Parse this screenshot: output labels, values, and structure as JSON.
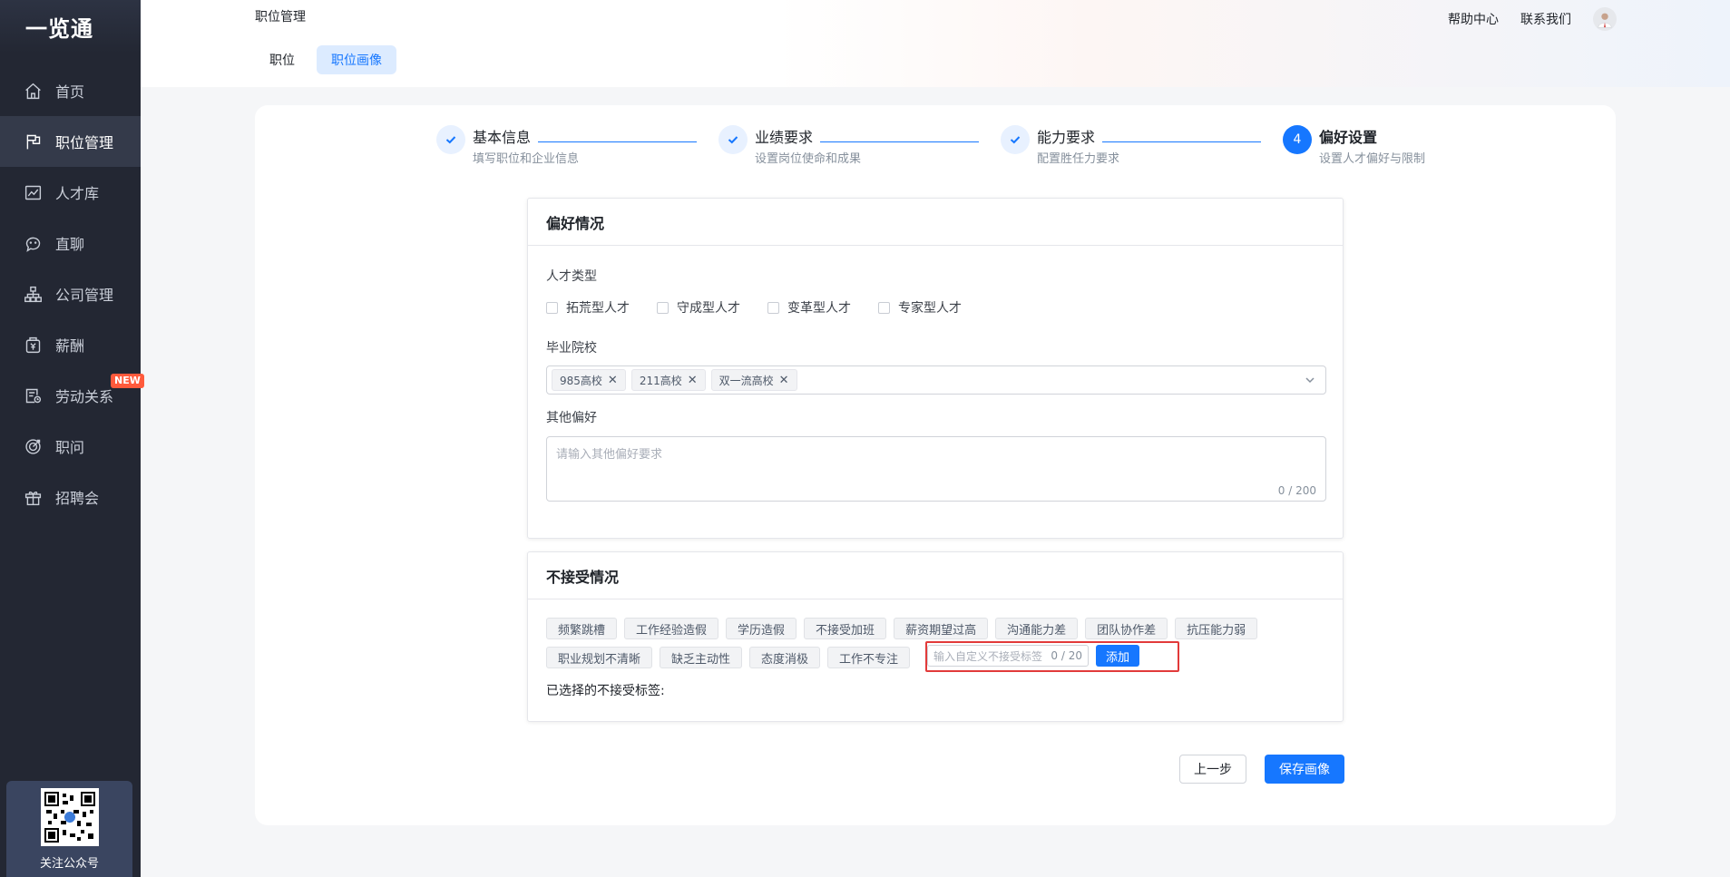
{
  "app": {
    "logo": "一览通"
  },
  "sidebar": {
    "items": [
      {
        "label": "首页",
        "icon": "home-icon"
      },
      {
        "label": "职位管理",
        "icon": "flag-icon",
        "active": true
      },
      {
        "label": "人才库",
        "icon": "chart-icon"
      },
      {
        "label": "直聊",
        "icon": "chat-icon"
      },
      {
        "label": "公司管理",
        "icon": "org-icon"
      },
      {
        "label": "薪酬",
        "icon": "salary-icon"
      },
      {
        "label": "劳动关系",
        "icon": "contract-icon",
        "badge": "NEW"
      },
      {
        "label": "职问",
        "icon": "target-icon"
      },
      {
        "label": "招聘会",
        "icon": "gift-icon"
      }
    ],
    "qr_label": "关注公众号"
  },
  "header": {
    "title": "职位管理",
    "help": "帮助中心",
    "contact": "联系我们",
    "tabs": [
      {
        "label": "职位"
      },
      {
        "label": "职位画像",
        "active": true
      }
    ]
  },
  "steps": [
    {
      "title": "基本信息",
      "desc": "填写职位和企业信息",
      "state": "done"
    },
    {
      "title": "业绩要求",
      "desc": "设置岗位使命和成果",
      "state": "done"
    },
    {
      "title": "能力要求",
      "desc": "配置胜任力要求",
      "state": "done"
    },
    {
      "title": "偏好设置",
      "desc": "设置人才偏好与限制",
      "state": "current",
      "number": "4"
    }
  ],
  "preference": {
    "heading": "偏好情况",
    "talent_type_label": "人才类型",
    "talent_types": [
      "拓荒型人才",
      "守成型人才",
      "变革型人才",
      "专家型人才"
    ],
    "school_label": "毕业院校",
    "schools": [
      "985高校",
      "211高校",
      "双一流高校"
    ],
    "other_label": "其他偏好",
    "other_placeholder": "请输入其他偏好要求",
    "other_count": "0 / 200"
  },
  "reject": {
    "heading": "不接受情况",
    "tags": [
      "频繁跳槽",
      "工作经验造假",
      "学历造假",
      "不接受加班",
      "薪资期望过高",
      "沟通能力差",
      "团队协作差",
      "抗压能力弱",
      "职业规划不清晰",
      "缺乏主动性",
      "态度消极",
      "工作不专注"
    ],
    "custom_placeholder": "输入自定义不接受标签",
    "custom_count": "0 / 20",
    "add_label": "添加",
    "selected_label": "已选择的不接受标签:"
  },
  "actions": {
    "prev": "上一步",
    "save": "保存画像"
  },
  "colors": {
    "primary": "#1677ff",
    "sidebar_bg": "#232733",
    "highlight": "#e23a3a",
    "badge": "#ff5a3c"
  }
}
